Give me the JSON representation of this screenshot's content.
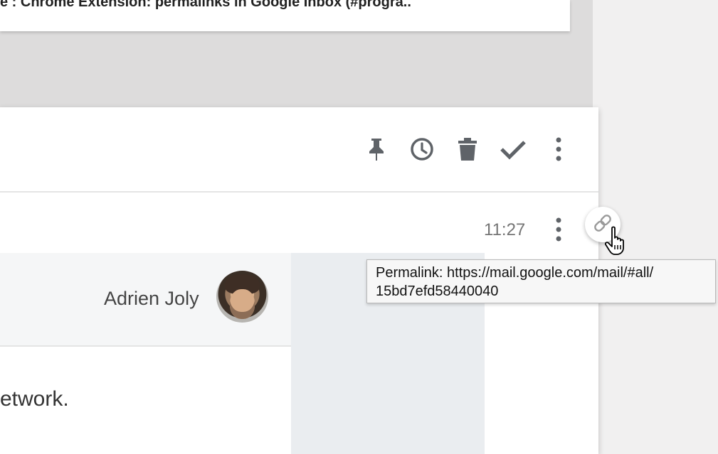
{
  "previous_email": {
    "subject": "e : Chrome Extension: permalinks in Google Inbox (#progra.."
  },
  "toolbar": {
    "icons": [
      "pin-icon",
      "snooze-clock-icon",
      "trash-icon",
      "done-check-icon",
      "more-vert-icon"
    ]
  },
  "message": {
    "time": "11:27",
    "sender_name": "Adrien Joly",
    "body_fragment": "etwork."
  },
  "tooltip": {
    "line1": "Permalink: https://mail.google.com/mail/#all/",
    "line2": "15bd7efd58440040"
  },
  "colors": {
    "icon_gray": "#5f6368",
    "panel_bg": "#ffffff",
    "backdrop": "#dddcdc",
    "side_pane": "#eaedf0"
  }
}
